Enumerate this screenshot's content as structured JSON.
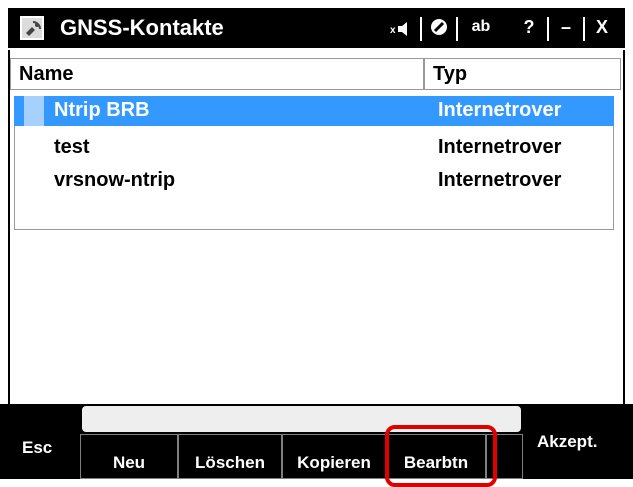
{
  "window": {
    "title": "GNSS-Kontakte",
    "titlebar_buttons": {
      "keyboard_label": "ab",
      "help_label": "?",
      "minimize_label": "–",
      "close_label": "X"
    }
  },
  "table": {
    "columns": [
      "Name",
      "Typ"
    ],
    "rows": [
      {
        "name": "Ntrip BRB",
        "typ": "Internetrover",
        "selected": true
      },
      {
        "name": "test",
        "typ": "Internetrover",
        "selected": false
      },
      {
        "name": "vrsnow-ntrip",
        "typ": "Internetrover",
        "selected": false
      }
    ]
  },
  "softkeys": {
    "esc": "Esc",
    "neu": "Neu",
    "loeschen": "Löschen",
    "kopieren": "Kopieren",
    "bearbeiten": "Bearbtn",
    "akzept": "Akzept."
  },
  "colors": {
    "selection": "#3399ff",
    "highlight": "#e00000",
    "titlebar": "#000000"
  },
  "icons": {
    "app": "satellite-icon",
    "sound": "speaker-icon",
    "tool": "circle-slash-icon"
  }
}
